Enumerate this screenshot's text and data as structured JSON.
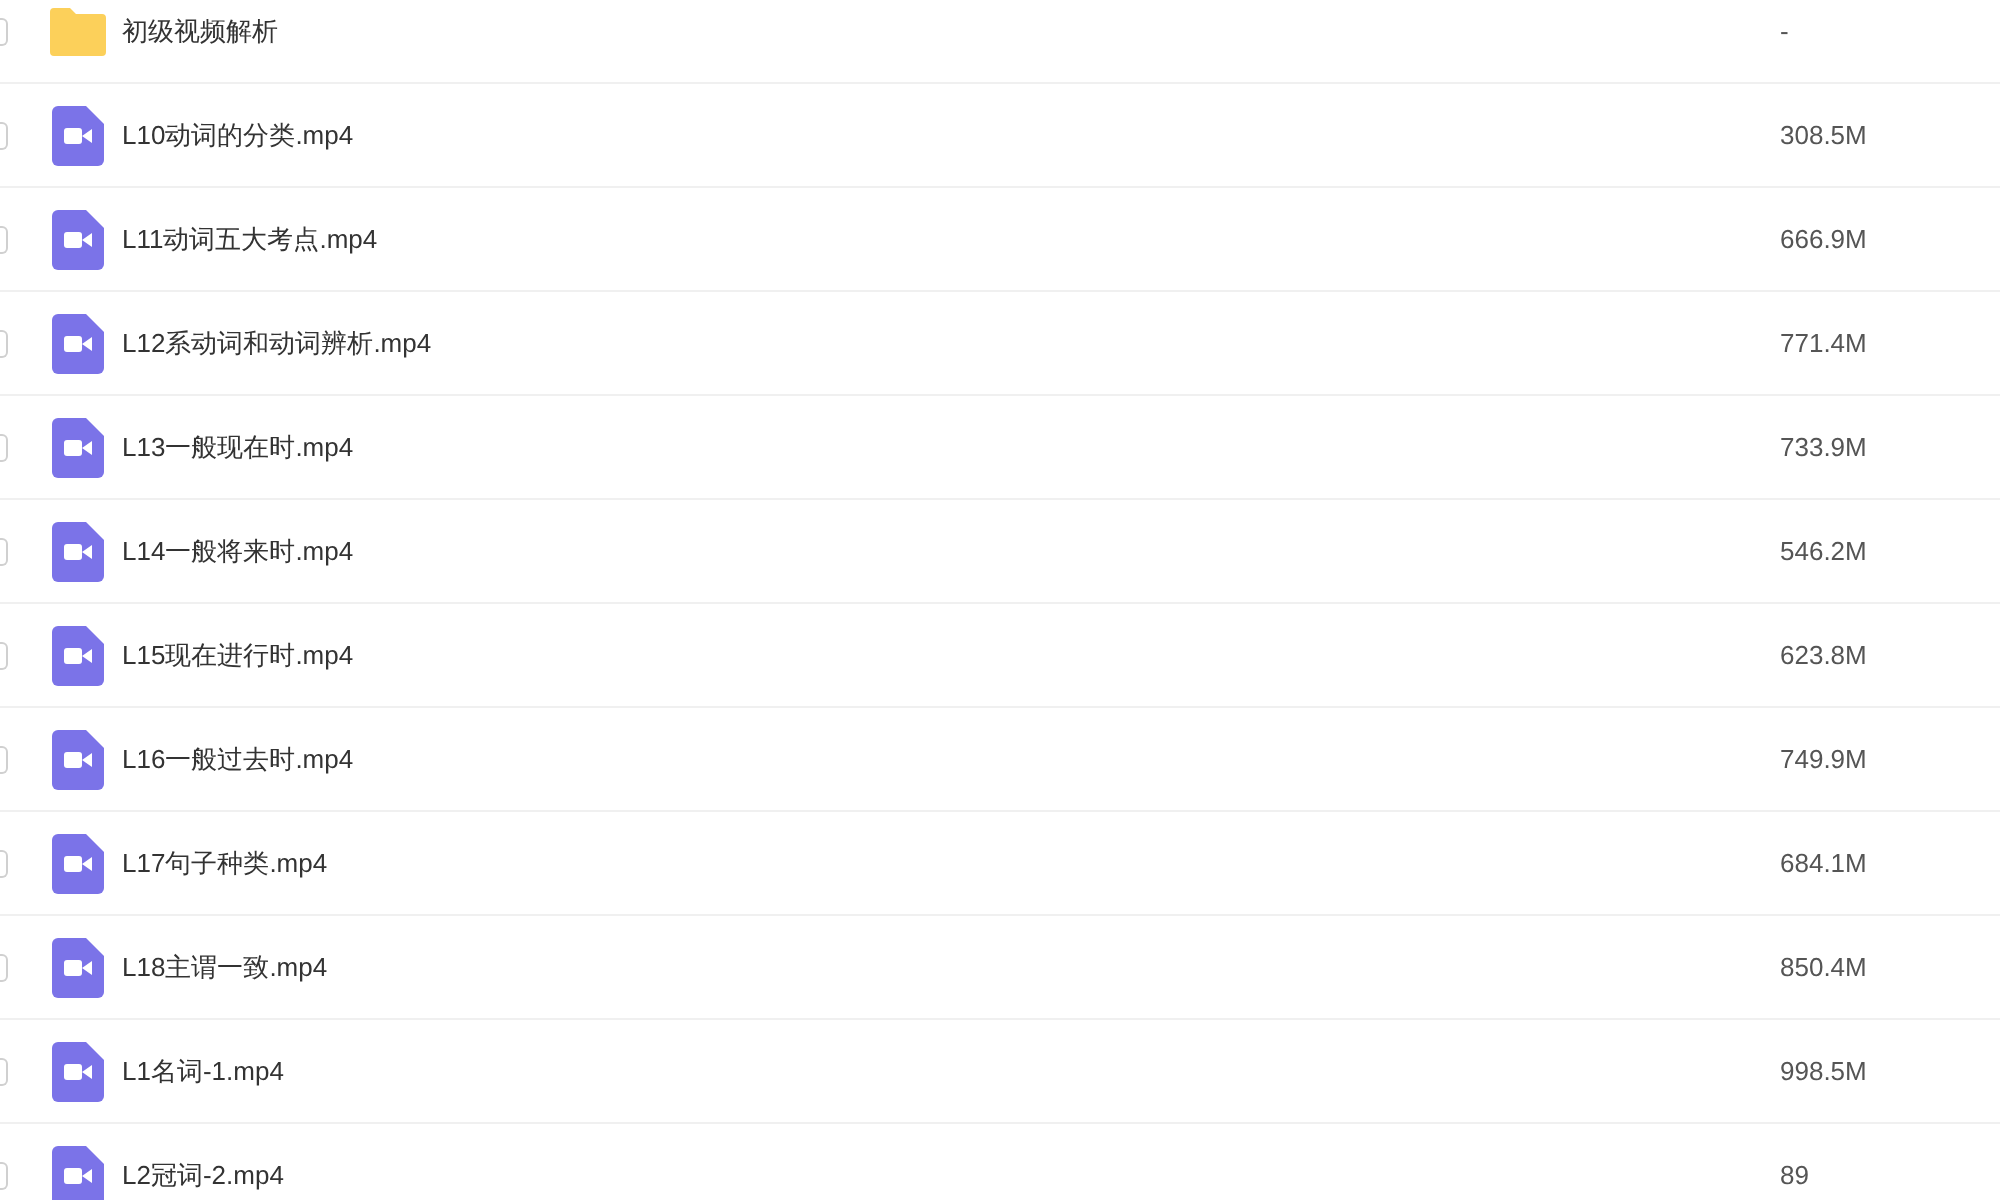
{
  "files": [
    {
      "kind": "folder",
      "name": "初级视频解析",
      "size": "-",
      "checked": false
    },
    {
      "kind": "video",
      "name": "L10动词的分类.mp4",
      "size": "308.5M",
      "checked": false
    },
    {
      "kind": "video",
      "name": "L11动词五大考点.mp4",
      "size": "666.9M",
      "checked": false
    },
    {
      "kind": "video",
      "name": "L12系动词和动词辨析.mp4",
      "size": "771.4M",
      "checked": false
    },
    {
      "kind": "video",
      "name": "L13一般现在时.mp4",
      "size": "733.9M",
      "checked": false
    },
    {
      "kind": "video",
      "name": "L14一般将来时.mp4",
      "size": "546.2M",
      "checked": false
    },
    {
      "kind": "video",
      "name": "L15现在进行时.mp4",
      "size": "623.8M",
      "checked": false
    },
    {
      "kind": "video",
      "name": "L16一般过去时.mp4",
      "size": "749.9M",
      "checked": false
    },
    {
      "kind": "video",
      "name": "L17句子种类.mp4",
      "size": "684.1M",
      "checked": false
    },
    {
      "kind": "video",
      "name": "L18主谓一致.mp4",
      "size": "850.4M",
      "checked": false
    },
    {
      "kind": "video",
      "name": "L1名词-1.mp4",
      "size": "998.5M",
      "checked": false
    },
    {
      "kind": "video",
      "name": "L2冠词-2.mp4",
      "size": "89",
      "checked": false
    }
  ]
}
